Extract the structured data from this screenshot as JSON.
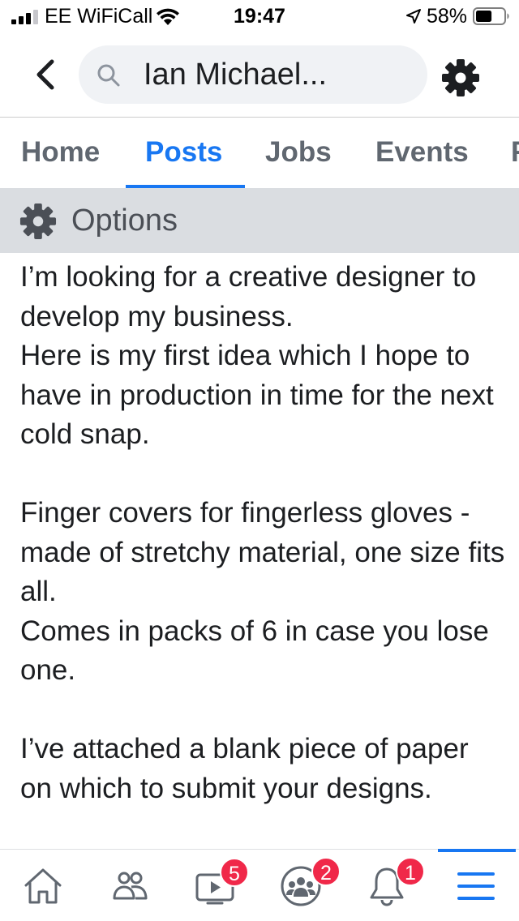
{
  "status_bar": {
    "carrier": "EE WiFiCall",
    "time": "19:47",
    "battery_percent": "58%",
    "battery_level": 0.58,
    "icons": [
      "signal-icon",
      "wifi-icon",
      "location-icon",
      "battery-icon"
    ]
  },
  "header": {
    "back_icon": "back-chevron-icon",
    "search_text": "Ian Michael...",
    "search_icon": "search-icon",
    "settings_icon": "gear-icon"
  },
  "tabs": [
    {
      "label": "Home",
      "active": false
    },
    {
      "label": "Posts",
      "active": true
    },
    {
      "label": "Jobs",
      "active": false
    },
    {
      "label": "Events",
      "active": false
    },
    {
      "label": "F",
      "active": false
    }
  ],
  "options": {
    "label": "Options",
    "icon": "gear-icon"
  },
  "post": {
    "paragraphs": [
      "I’m looking for a creative designer to develop my business.\nHere is my first idea which I hope to have in production in time for the next cold snap.",
      "Finger covers for fingerless gloves - made of stretchy material, one size fits all.\nComes in packs of 6 in case you lose one.",
      "I’ve attached a blank piece of paper on which to submit your designs."
    ]
  },
  "bottom_nav": [
    {
      "icon": "home-icon",
      "badge": ""
    },
    {
      "icon": "friends-icon",
      "badge": ""
    },
    {
      "icon": "watch-icon",
      "badge": "5"
    },
    {
      "icon": "groups-icon",
      "badge": "2"
    },
    {
      "icon": "bell-icon",
      "badge": "1"
    },
    {
      "icon": "menu-icon",
      "badge": "",
      "active": true
    }
  ],
  "colors": {
    "accent": "#1877f2",
    "badge": "#f02849",
    "options_bg": "#dadde1",
    "icon_gray": "#606770"
  }
}
